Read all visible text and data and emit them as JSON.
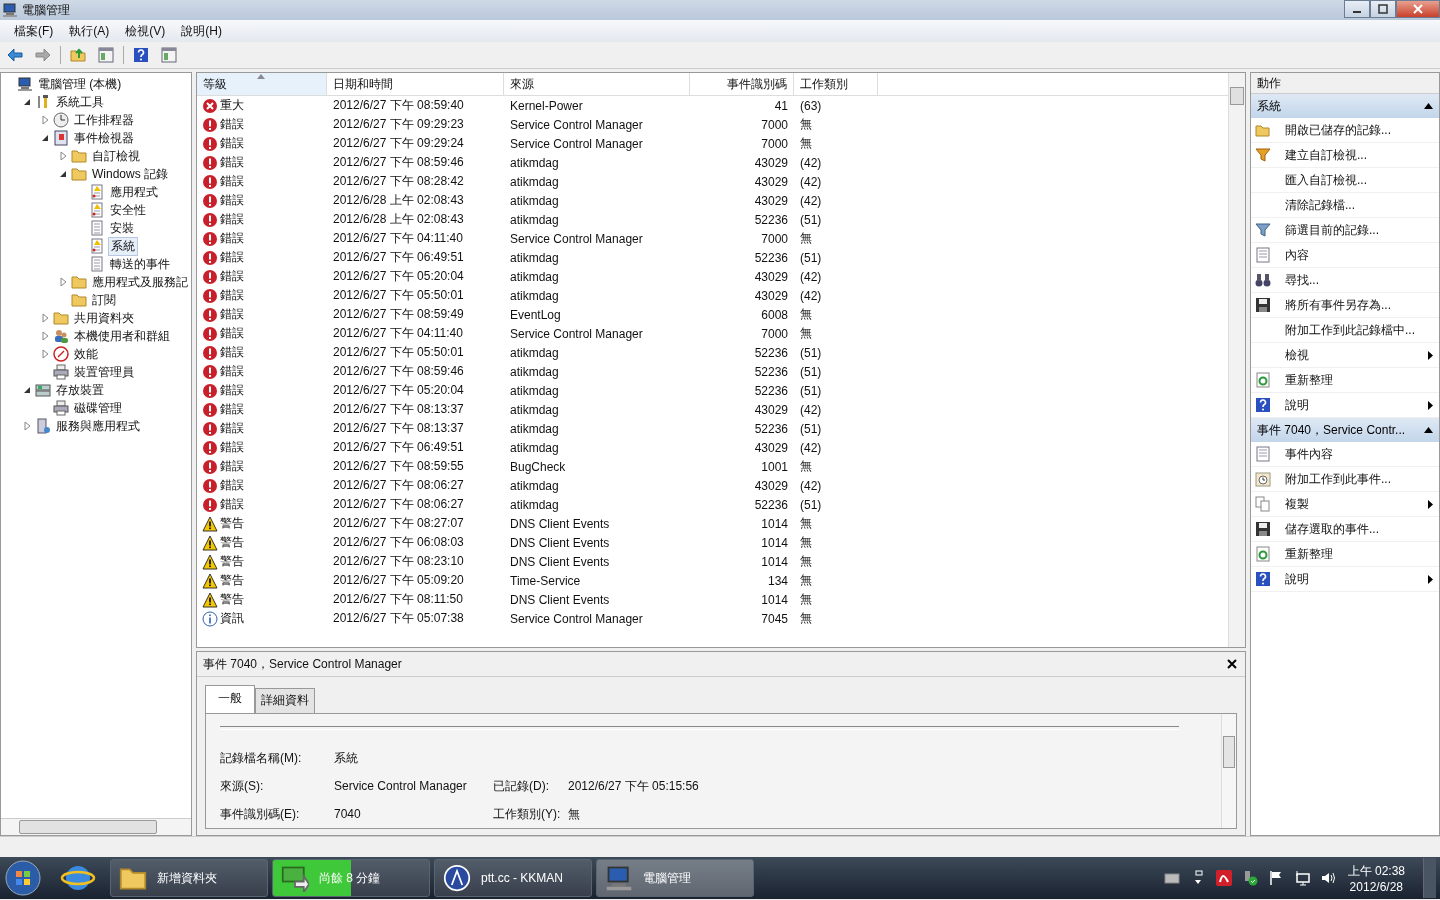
{
  "window": {
    "title": "電腦管理"
  },
  "menu": [
    "檔案(F)",
    "執行(A)",
    "檢視(V)",
    "說明(H)"
  ],
  "toolbar": [
    {
      "kind": "back"
    },
    {
      "kind": "forward"
    },
    {
      "kind": "up"
    },
    {
      "kind": "pane"
    },
    {
      "kind": "help"
    },
    {
      "kind": "pane"
    }
  ],
  "tree": [
    {
      "label": "電腦管理 (本機)",
      "kind": "computer",
      "selected": false,
      "children": [
        {
          "label": "系統工具",
          "kind": "tools",
          "expanded": true,
          "selected": false,
          "children": [
            {
              "label": "工作排程器",
              "kind": "clock",
              "expanded": false,
              "selected": false
            },
            {
              "label": "事件檢視器",
              "kind": "viewer",
              "expanded": true,
              "selected": false,
              "children": [
                {
                  "label": "自訂檢視",
                  "kind": "folder",
                  "expanded": false,
                  "selected": false
                },
                {
                  "label": "Windows 記錄",
                  "kind": "folder",
                  "expanded": true,
                  "selected": false,
                  "children": [
                    {
                      "label": "應用程式",
                      "kind": "logwarn",
                      "selected": false
                    },
                    {
                      "label": "安全性",
                      "kind": "logwarn",
                      "selected": false
                    },
                    {
                      "label": "安裝",
                      "kind": "log",
                      "selected": false
                    },
                    {
                      "label": "系統",
                      "kind": "logwarn",
                      "selected": true
                    },
                    {
                      "label": "轉送的事件",
                      "kind": "log",
                      "selected": false
                    }
                  ]
                },
                {
                  "label": "應用程式及服務記",
                  "kind": "folder",
                  "expanded": false,
                  "selected": false
                },
                {
                  "label": "訂閱",
                  "kind": "folder",
                  "selected": false
                }
              ]
            },
            {
              "label": "共用資料夾",
              "kind": "folder",
              "expanded": false,
              "selected": false
            },
            {
              "label": "本機使用者和群組",
              "kind": "users",
              "expanded": false,
              "selected": false
            },
            {
              "label": "效能",
              "kind": "perf",
              "expanded": false,
              "selected": false
            },
            {
              "label": "裝置管理員",
              "kind": "device",
              "selected": false
            }
          ]
        },
        {
          "label": "存放裝置",
          "kind": "storage",
          "expanded": true,
          "selected": false,
          "children": [
            {
              "label": "磁碟管理",
              "kind": "device",
              "selected": false
            }
          ]
        },
        {
          "label": "服務與應用程式",
          "kind": "services",
          "expanded": false,
          "selected": false
        }
      ]
    }
  ],
  "table": {
    "columns": [
      {
        "label": "等級",
        "sorted": true
      },
      {
        "label": "日期和時間",
        "sorted": false
      },
      {
        "label": "來源",
        "sorted": false
      },
      {
        "label": "事件識別碼",
        "sorted": false
      },
      {
        "label": "工作類別",
        "sorted": false
      }
    ],
    "rows": [
      {
        "kind": "critical",
        "level": "重大",
        "date_time": "2012/6/27 下午 08:59:40",
        "source": "Kernel-Power",
        "event_id": "41",
        "task_category": "(63)",
        "selected": false
      },
      {
        "kind": "error",
        "level": "錯誤",
        "date_time": "2012/6/27 下午 09:29:23",
        "source": "Service Control Manager",
        "event_id": "7000",
        "task_category": "無",
        "selected": false
      },
      {
        "kind": "error",
        "level": "錯誤",
        "date_time": "2012/6/27 下午 09:29:24",
        "source": "Service Control Manager",
        "event_id": "7000",
        "task_category": "無",
        "selected": false
      },
      {
        "kind": "error",
        "level": "錯誤",
        "date_time": "2012/6/27 下午 08:59:46",
        "source": "atikmdag",
        "event_id": "43029",
        "task_category": "(42)",
        "selected": false
      },
      {
        "kind": "error",
        "level": "錯誤",
        "date_time": "2012/6/27 下午 08:28:42",
        "source": "atikmdag",
        "event_id": "43029",
        "task_category": "(42)",
        "selected": false
      },
      {
        "kind": "error",
        "level": "錯誤",
        "date_time": "2012/6/28 上午 02:08:43",
        "source": "atikmdag",
        "event_id": "43029",
        "task_category": "(42)",
        "selected": false
      },
      {
        "kind": "error",
        "level": "錯誤",
        "date_time": "2012/6/28 上午 02:08:43",
        "source": "atikmdag",
        "event_id": "52236",
        "task_category": "(51)",
        "selected": false
      },
      {
        "kind": "error",
        "level": "錯誤",
        "date_time": "2012/6/27 下午 04:11:40",
        "source": "Service Control Manager",
        "event_id": "7000",
        "task_category": "無",
        "selected": false
      },
      {
        "kind": "error",
        "level": "錯誤",
        "date_time": "2012/6/27 下午 06:49:51",
        "source": "atikmdag",
        "event_id": "52236",
        "task_category": "(51)",
        "selected": false
      },
      {
        "kind": "error",
        "level": "錯誤",
        "date_time": "2012/6/27 下午 05:20:04",
        "source": "atikmdag",
        "event_id": "43029",
        "task_category": "(42)",
        "selected": false
      },
      {
        "kind": "error",
        "level": "錯誤",
        "date_time": "2012/6/27 下午 05:50:01",
        "source": "atikmdag",
        "event_id": "43029",
        "task_category": "(42)",
        "selected": false
      },
      {
        "kind": "error",
        "level": "錯誤",
        "date_time": "2012/6/27 下午 08:59:49",
        "source": "EventLog",
        "event_id": "6008",
        "task_category": "無",
        "selected": false
      },
      {
        "kind": "error",
        "level": "錯誤",
        "date_time": "2012/6/27 下午 04:11:40",
        "source": "Service Control Manager",
        "event_id": "7000",
        "task_category": "無",
        "selected": false
      },
      {
        "kind": "error",
        "level": "錯誤",
        "date_time": "2012/6/27 下午 05:50:01",
        "source": "atikmdag",
        "event_id": "52236",
        "task_category": "(51)",
        "selected": false
      },
      {
        "kind": "error",
        "level": "錯誤",
        "date_time": "2012/6/27 下午 08:59:46",
        "source": "atikmdag",
        "event_id": "52236",
        "task_category": "(51)",
        "selected": false
      },
      {
        "kind": "error",
        "level": "錯誤",
        "date_time": "2012/6/27 下午 05:20:04",
        "source": "atikmdag",
        "event_id": "52236",
        "task_category": "(51)",
        "selected": false
      },
      {
        "kind": "error",
        "level": "錯誤",
        "date_time": "2012/6/27 下午 08:13:37",
        "source": "atikmdag",
        "event_id": "43029",
        "task_category": "(42)",
        "selected": false
      },
      {
        "kind": "error",
        "level": "錯誤",
        "date_time": "2012/6/27 下午 08:13:37",
        "source": "atikmdag",
        "event_id": "52236",
        "task_category": "(51)",
        "selected": false
      },
      {
        "kind": "error",
        "level": "錯誤",
        "date_time": "2012/6/27 下午 06:49:51",
        "source": "atikmdag",
        "event_id": "43029",
        "task_category": "(42)",
        "selected": false
      },
      {
        "kind": "error",
        "level": "錯誤",
        "date_time": "2012/6/27 下午 08:59:55",
        "source": "BugCheck",
        "event_id": "1001",
        "task_category": "無",
        "selected": false
      },
      {
        "kind": "error",
        "level": "錯誤",
        "date_time": "2012/6/27 下午 08:06:27",
        "source": "atikmdag",
        "event_id": "43029",
        "task_category": "(42)",
        "selected": false
      },
      {
        "kind": "error",
        "level": "錯誤",
        "date_time": "2012/6/27 下午 08:06:27",
        "source": "atikmdag",
        "event_id": "52236",
        "task_category": "(51)",
        "selected": false
      },
      {
        "kind": "warning",
        "level": "警告",
        "date_time": "2012/6/27 下午 08:27:07",
        "source": "DNS Client Events",
        "event_id": "1014",
        "task_category": "無",
        "selected": false
      },
      {
        "kind": "warning",
        "level": "警告",
        "date_time": "2012/6/27 下午 06:08:03",
        "source": "DNS Client Events",
        "event_id": "1014",
        "task_category": "無",
        "selected": false
      },
      {
        "kind": "warning",
        "level": "警告",
        "date_time": "2012/6/27 下午 08:23:10",
        "source": "DNS Client Events",
        "event_id": "1014",
        "task_category": "無",
        "selected": false
      },
      {
        "kind": "warning",
        "level": "警告",
        "date_time": "2012/6/27 下午 05:09:20",
        "source": "Time-Service",
        "event_id": "134",
        "task_category": "無",
        "selected": false
      },
      {
        "kind": "warning",
        "level": "警告",
        "date_time": "2012/6/27 下午 08:11:50",
        "source": "DNS Client Events",
        "event_id": "1014",
        "task_category": "無",
        "selected": false
      },
      {
        "kind": "info",
        "level": "資訊",
        "date_time": "2012/6/27 下午 05:07:38",
        "source": "Service Control Manager",
        "event_id": "7045",
        "task_category": "無",
        "selected": false
      }
    ]
  },
  "detail": {
    "title": "事件 7040，Service Control Manager",
    "tabs": [
      {
        "label": "一般",
        "selected": true
      },
      {
        "label": "詳細資料",
        "selected": false
      }
    ],
    "rows": [
      [
        {
          "label": "記錄檔名稱(M):",
          "value": "系統"
        }
      ],
      [
        {
          "label": "來源(S):",
          "value": "Service Control Manager"
        },
        {
          "label": "已記錄(D):",
          "value": "2012/6/27 下午 05:15:56"
        }
      ],
      [
        {
          "label": "事件識別碼(E):",
          "value": "7040"
        },
        {
          "label": "工作類別(Y):",
          "value": "無"
        }
      ]
    ]
  },
  "actions": {
    "title": "動作",
    "sections": [
      {
        "title": "系統",
        "expanded": true,
        "items": [
          {
            "label": "開啟已儲存的記錄...",
            "kind": "open",
            "submenu": false
          },
          {
            "label": "建立自訂檢視...",
            "kind": "filter",
            "submenu": false
          },
          {
            "label": "匯入自訂檢視...",
            "kind": "none",
            "submenu": false
          },
          {
            "label": "清除記錄檔...",
            "kind": "none",
            "submenu": false
          },
          {
            "label": "篩選目前的記錄...",
            "kind": "funnel",
            "submenu": false
          },
          {
            "label": "內容",
            "kind": "props",
            "submenu": false
          },
          {
            "label": "尋找...",
            "kind": "find",
            "submenu": false
          },
          {
            "label": "將所有事件另存為...",
            "kind": "save",
            "submenu": false
          },
          {
            "label": "附加工作到此記錄檔中...",
            "kind": "none",
            "submenu": false
          },
          {
            "label": "檢視",
            "kind": "none",
            "submenu": true
          },
          {
            "label": "重新整理",
            "kind": "refresh",
            "submenu": false
          },
          {
            "label": "說明",
            "kind": "help",
            "submenu": true
          }
        ]
      },
      {
        "title": "事件 7040，Service Contr...",
        "expanded": true,
        "items": [
          {
            "label": "事件內容",
            "kind": "props",
            "submenu": false
          },
          {
            "label": "附加工作到此事件...",
            "kind": "task",
            "submenu": false
          },
          {
            "label": "複製",
            "kind": "copy",
            "submenu": true
          },
          {
            "label": "儲存選取的事件...",
            "kind": "save",
            "submenu": false
          },
          {
            "label": "重新整理",
            "kind": "refresh",
            "submenu": false
          },
          {
            "label": "說明",
            "kind": "help",
            "submenu": true
          }
        ]
      }
    ]
  },
  "taskbar": {
    "items": [
      {
        "label": "新增資料夾",
        "kind": "folder",
        "selected": false
      },
      {
        "label": "尚餘 8 分鐘",
        "kind": "copy-progress",
        "selected": false,
        "level": 0.5
      },
      {
        "label": "ptt.cc - KKMAN",
        "kind": "browser",
        "selected": false
      },
      {
        "label": "電腦管理",
        "kind": "computer",
        "selected": true
      }
    ],
    "clock": {
      "time": "上午 02:38",
      "date": "2012/6/28"
    }
  }
}
